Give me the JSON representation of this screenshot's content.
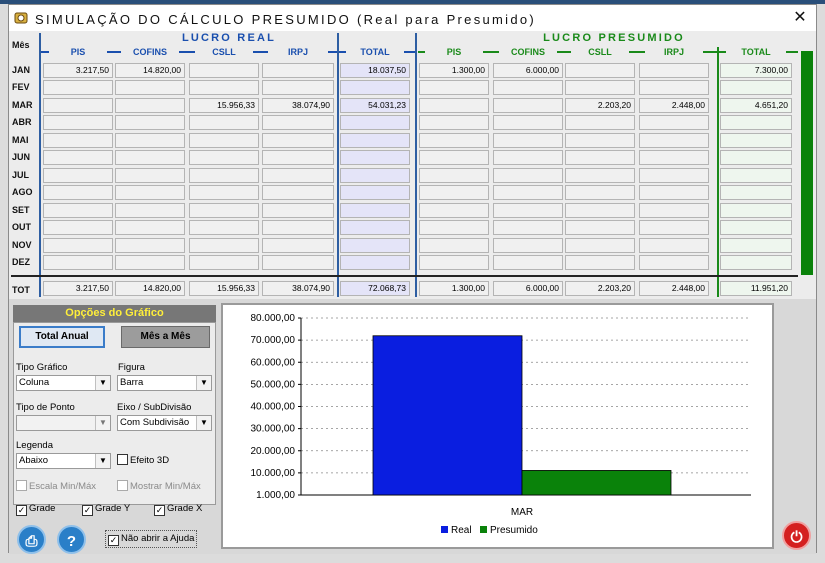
{
  "window": {
    "title": "SIMULAÇÃO DO CÁLCULO PRESUMIDO (Real para Presumido)"
  },
  "grid": {
    "mes_label": "Mês",
    "group_real": "LUCRO REAL",
    "group_presumido": "LUCRO PRESUMIDO",
    "real_columns": [
      "PIS",
      "COFINS",
      "CSLL",
      "IRPJ",
      "TOTAL"
    ],
    "pres_columns": [
      "PIS",
      "COFINS",
      "CSLL",
      "IRPJ",
      "TOTAL"
    ],
    "months": [
      "JAN",
      "FEV",
      "MAR",
      "ABR",
      "MAI",
      "JUN",
      "JUL",
      "AGO",
      "SET",
      "OUT",
      "NOV",
      "DEZ"
    ],
    "rows": [
      {
        "real": [
          "3.217,50",
          "14.820,00",
          "",
          "",
          "18.037,50"
        ],
        "pres": [
          "1.300,00",
          "6.000,00",
          "",
          "",
          "7.300,00"
        ]
      },
      {
        "real": [
          "",
          "",
          "",
          "",
          ""
        ],
        "pres": [
          "",
          "",
          "",
          "",
          ""
        ]
      },
      {
        "real": [
          "",
          "",
          "15.956,33",
          "38.074,90",
          "54.031,23"
        ],
        "pres": [
          "",
          "",
          "2.203,20",
          "2.448,00",
          "4.651,20"
        ]
      },
      {
        "real": [
          "",
          "",
          "",
          "",
          ""
        ],
        "pres": [
          "",
          "",
          "",
          "",
          ""
        ]
      },
      {
        "real": [
          "",
          "",
          "",
          "",
          ""
        ],
        "pres": [
          "",
          "",
          "",
          "",
          ""
        ]
      },
      {
        "real": [
          "",
          "",
          "",
          "",
          ""
        ],
        "pres": [
          "",
          "",
          "",
          "",
          ""
        ]
      },
      {
        "real": [
          "",
          "",
          "",
          "",
          ""
        ],
        "pres": [
          "",
          "",
          "",
          "",
          ""
        ]
      },
      {
        "real": [
          "",
          "",
          "",
          "",
          ""
        ],
        "pres": [
          "",
          "",
          "",
          "",
          ""
        ]
      },
      {
        "real": [
          "",
          "",
          "",
          "",
          ""
        ],
        "pres": [
          "",
          "",
          "",
          "",
          ""
        ]
      },
      {
        "real": [
          "",
          "",
          "",
          "",
          ""
        ],
        "pres": [
          "",
          "",
          "",
          "",
          ""
        ]
      },
      {
        "real": [
          "",
          "",
          "",
          "",
          ""
        ],
        "pres": [
          "",
          "",
          "",
          "",
          ""
        ]
      },
      {
        "real": [
          "",
          "",
          "",
          "",
          ""
        ],
        "pres": [
          "",
          "",
          "",
          "",
          ""
        ]
      }
    ],
    "total_label": "TOT",
    "totals": {
      "real": [
        "3.217,50",
        "14.820,00",
        "15.956,33",
        "38.074,90",
        "72.068,73"
      ],
      "pres": [
        "1.300,00",
        "6.000,00",
        "2.203,20",
        "2.448,00",
        "11.951,20"
      ]
    }
  },
  "options": {
    "title": "Opções do Gráfico",
    "btn_total_anual": "Total Anual",
    "btn_mes_a_mes": "Mês a Mês",
    "tipo_grafico_label": "Tipo Gráfico",
    "tipo_grafico_value": "Coluna",
    "figura_label": "Figura",
    "figura_value": "Barra",
    "tipo_ponto_label": "Tipo de Ponto",
    "tipo_ponto_value": "",
    "eixo_label": "Eixo / SubDivisão",
    "eixo_value": "Com Subdivisão",
    "legenda_label": "Legenda",
    "legenda_value": "Abaixo",
    "efeito3d_label": "Efeito 3D",
    "escala_label": "Escala Min/Máx",
    "mostrar_label": "Mostrar Min/Máx",
    "grade_label": "Grade",
    "grade_y_label": "Grade Y",
    "grade_x_label": "Grade X",
    "nao_abrir_label": "Não abrir a Ajuda"
  },
  "colors": {
    "real": "#0a1ee0",
    "presumido": "#0a820a",
    "real_header": "#1a4fae",
    "presumido_header": "#1a8a1a"
  },
  "icons": {
    "print": "printer-icon",
    "help": "help-icon",
    "power": "power-icon"
  },
  "chart_data": {
    "type": "bar",
    "categories": [
      "MAR"
    ],
    "series": [
      {
        "name": "Real",
        "values": [
          72068.73
        ]
      },
      {
        "name": "Presumido",
        "values": [
          11951.2
        ]
      }
    ],
    "y_ticks": [
      "80.000,00",
      "70.000,00",
      "60.000,00",
      "50.000,00",
      "40.000,00",
      "30.000,00",
      "20.000,00",
      "10.000,00",
      "1.000,00"
    ],
    "ylim": [
      1000,
      80000
    ],
    "grid": {
      "y": true,
      "x": true
    },
    "legend": "bottom"
  }
}
